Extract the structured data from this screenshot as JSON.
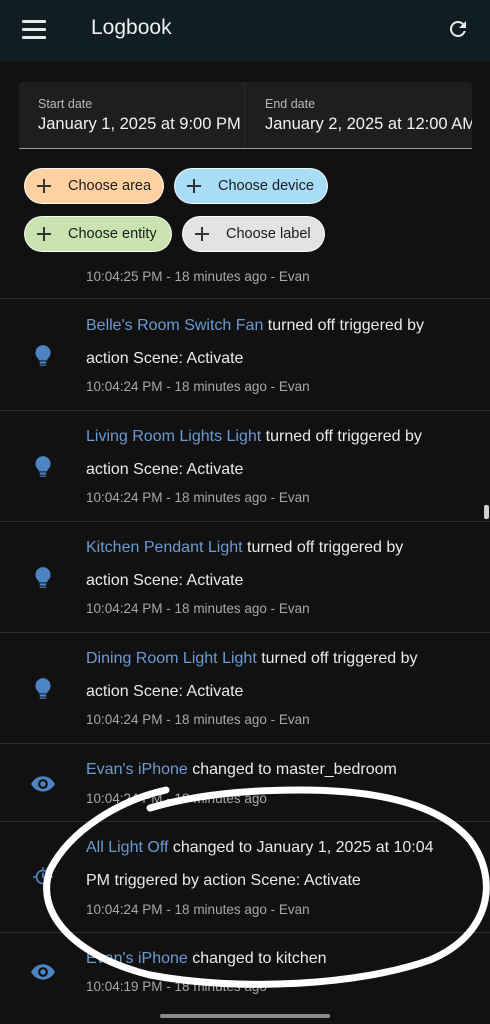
{
  "appbar": {
    "title": "Logbook"
  },
  "filters": {
    "start_date": {
      "label": "Start date",
      "value": "January 1, 2025 at 9:00 PM"
    },
    "end_date": {
      "label": "End date",
      "value": "January 2, 2025 at 12:00 AM"
    },
    "chips": {
      "area": "Choose area",
      "device": "Choose device",
      "entity": "Choose entity",
      "label": "Choose label"
    }
  },
  "entries": [
    {
      "meta": "10:04:25 PM - 18 minutes ago - Evan"
    },
    {
      "entity": "Belle's Room Switch Fan",
      "message": " turned off triggered by",
      "message2": "action Scene: Activate",
      "meta": "10:04:24 PM - 18 minutes ago - Evan",
      "icon": "lightbulb-icon"
    },
    {
      "entity": "Living Room Lights Light",
      "message": " turned off triggered by",
      "message2": "action Scene: Activate",
      "meta": "10:04:24 PM - 18 minutes ago - Evan",
      "icon": "lightbulb-icon"
    },
    {
      "entity": "Kitchen Pendant Light",
      "message": " turned off triggered by",
      "message2": "action Scene: Activate",
      "meta": "10:04:24 PM - 18 minutes ago - Evan",
      "icon": "lightbulb-icon"
    },
    {
      "entity": "Dining Room Light Light",
      "message": " turned off triggered by",
      "message2": "action Scene: Activate",
      "meta": "10:04:24 PM - 18 minutes ago - Evan",
      "icon": "lightbulb-icon"
    },
    {
      "entity": "Evan's iPhone",
      "message": " changed to master_bedroom",
      "meta": "10:04:24 PM - 18 minutes ago",
      "icon": "eye-icon"
    },
    {
      "entity": "All Light Off",
      "message": " changed to January 1, 2025 at 10:04",
      "message2": "PM triggered by action Scene: Activate",
      "meta": "10:04:24 PM - 18 minutes ago - Evan",
      "icon": "timer-icon"
    },
    {
      "entity": "Evan's iPhone",
      "message": " changed to kitchen",
      "meta": "10:04:19 PM - 18 minutes ago",
      "icon": "eye-icon"
    }
  ],
  "colors": {
    "appbar": "#101e24",
    "background": "#111111",
    "link": "#6b9bd1",
    "icon": "#4d84c4"
  }
}
